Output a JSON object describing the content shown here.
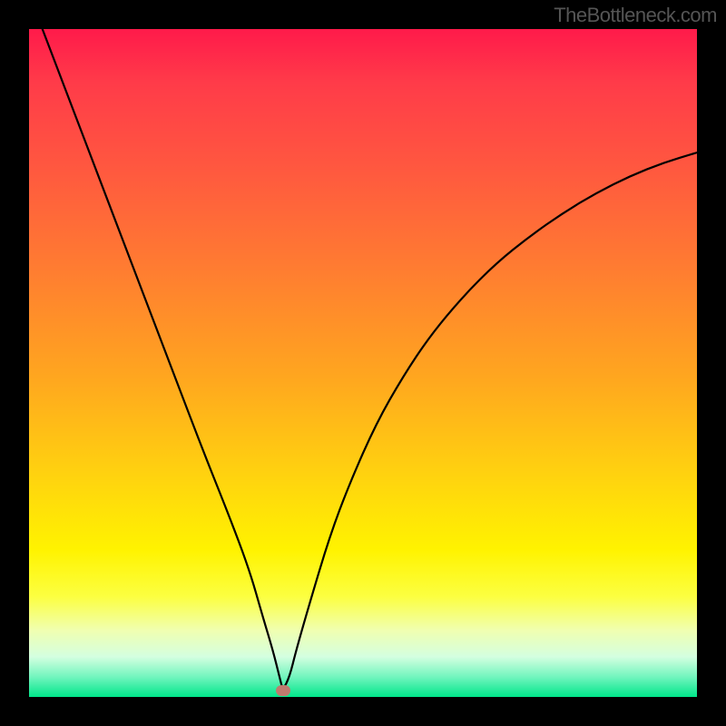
{
  "watermark": "TheBottleneck.com",
  "chart_data": {
    "type": "line",
    "title": "",
    "xlabel": "",
    "ylabel": "",
    "xlim": [
      0,
      100
    ],
    "ylim": [
      0,
      100
    ],
    "grid": false,
    "legend": false,
    "marker": {
      "x_pct": 38,
      "y_pct": 99
    },
    "series": [
      {
        "name": "curve",
        "color": "#000000",
        "x_pct": [
          2,
          6,
          10,
          14,
          18,
          22,
          26,
          30,
          33,
          35,
          36.5,
          37.5,
          38,
          39,
          40,
          42,
          45,
          48,
          52,
          56,
          60,
          65,
          70,
          75,
          80,
          85,
          90,
          95,
          100
        ],
        "y_pct": [
          0,
          10.5,
          21,
          31.5,
          42,
          52.5,
          63,
          73,
          81,
          88,
          93,
          97,
          99,
          97,
          93,
          86,
          76,
          68,
          59,
          52,
          46,
          40,
          35,
          31,
          27.5,
          24.5,
          22,
          20,
          18.5
        ]
      }
    ]
  }
}
